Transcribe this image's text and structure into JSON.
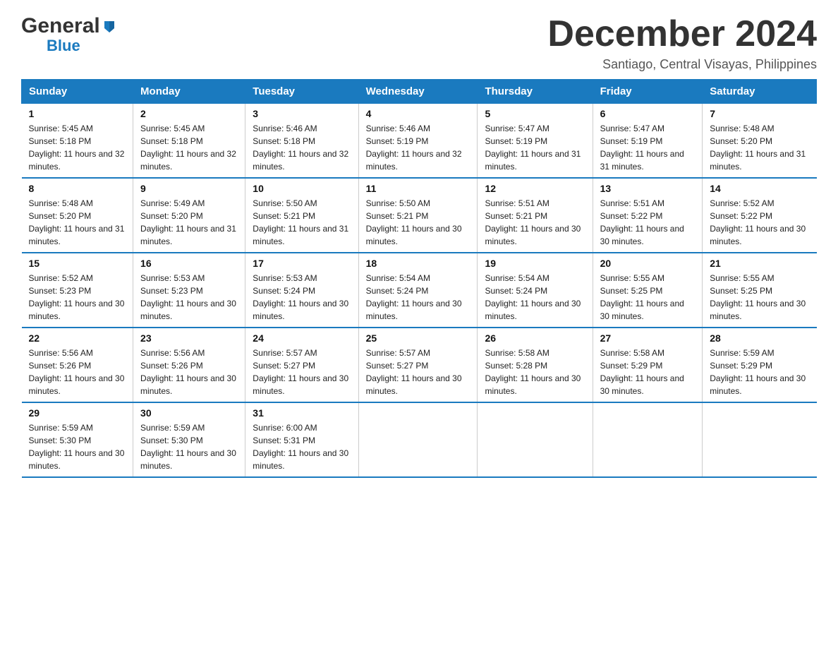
{
  "logo": {
    "general": "General",
    "blue": "Blue"
  },
  "title": {
    "month": "December 2024",
    "location": "Santiago, Central Visayas, Philippines"
  },
  "days_header": [
    "Sunday",
    "Monday",
    "Tuesday",
    "Wednesday",
    "Thursday",
    "Friday",
    "Saturday"
  ],
  "weeks": [
    [
      {
        "day": "1",
        "sunrise": "5:45 AM",
        "sunset": "5:18 PM",
        "daylight": "11 hours and 32 minutes."
      },
      {
        "day": "2",
        "sunrise": "5:45 AM",
        "sunset": "5:18 PM",
        "daylight": "11 hours and 32 minutes."
      },
      {
        "day": "3",
        "sunrise": "5:46 AM",
        "sunset": "5:18 PM",
        "daylight": "11 hours and 32 minutes."
      },
      {
        "day": "4",
        "sunrise": "5:46 AM",
        "sunset": "5:19 PM",
        "daylight": "11 hours and 32 minutes."
      },
      {
        "day": "5",
        "sunrise": "5:47 AM",
        "sunset": "5:19 PM",
        "daylight": "11 hours and 31 minutes."
      },
      {
        "day": "6",
        "sunrise": "5:47 AM",
        "sunset": "5:19 PM",
        "daylight": "11 hours and 31 minutes."
      },
      {
        "day": "7",
        "sunrise": "5:48 AM",
        "sunset": "5:20 PM",
        "daylight": "11 hours and 31 minutes."
      }
    ],
    [
      {
        "day": "8",
        "sunrise": "5:48 AM",
        "sunset": "5:20 PM",
        "daylight": "11 hours and 31 minutes."
      },
      {
        "day": "9",
        "sunrise": "5:49 AM",
        "sunset": "5:20 PM",
        "daylight": "11 hours and 31 minutes."
      },
      {
        "day": "10",
        "sunrise": "5:50 AM",
        "sunset": "5:21 PM",
        "daylight": "11 hours and 31 minutes."
      },
      {
        "day": "11",
        "sunrise": "5:50 AM",
        "sunset": "5:21 PM",
        "daylight": "11 hours and 30 minutes."
      },
      {
        "day": "12",
        "sunrise": "5:51 AM",
        "sunset": "5:21 PM",
        "daylight": "11 hours and 30 minutes."
      },
      {
        "day": "13",
        "sunrise": "5:51 AM",
        "sunset": "5:22 PM",
        "daylight": "11 hours and 30 minutes."
      },
      {
        "day": "14",
        "sunrise": "5:52 AM",
        "sunset": "5:22 PM",
        "daylight": "11 hours and 30 minutes."
      }
    ],
    [
      {
        "day": "15",
        "sunrise": "5:52 AM",
        "sunset": "5:23 PM",
        "daylight": "11 hours and 30 minutes."
      },
      {
        "day": "16",
        "sunrise": "5:53 AM",
        "sunset": "5:23 PM",
        "daylight": "11 hours and 30 minutes."
      },
      {
        "day": "17",
        "sunrise": "5:53 AM",
        "sunset": "5:24 PM",
        "daylight": "11 hours and 30 minutes."
      },
      {
        "day": "18",
        "sunrise": "5:54 AM",
        "sunset": "5:24 PM",
        "daylight": "11 hours and 30 minutes."
      },
      {
        "day": "19",
        "sunrise": "5:54 AM",
        "sunset": "5:24 PM",
        "daylight": "11 hours and 30 minutes."
      },
      {
        "day": "20",
        "sunrise": "5:55 AM",
        "sunset": "5:25 PM",
        "daylight": "11 hours and 30 minutes."
      },
      {
        "day": "21",
        "sunrise": "5:55 AM",
        "sunset": "5:25 PM",
        "daylight": "11 hours and 30 minutes."
      }
    ],
    [
      {
        "day": "22",
        "sunrise": "5:56 AM",
        "sunset": "5:26 PM",
        "daylight": "11 hours and 30 minutes."
      },
      {
        "day": "23",
        "sunrise": "5:56 AM",
        "sunset": "5:26 PM",
        "daylight": "11 hours and 30 minutes."
      },
      {
        "day": "24",
        "sunrise": "5:57 AM",
        "sunset": "5:27 PM",
        "daylight": "11 hours and 30 minutes."
      },
      {
        "day": "25",
        "sunrise": "5:57 AM",
        "sunset": "5:27 PM",
        "daylight": "11 hours and 30 minutes."
      },
      {
        "day": "26",
        "sunrise": "5:58 AM",
        "sunset": "5:28 PM",
        "daylight": "11 hours and 30 minutes."
      },
      {
        "day": "27",
        "sunrise": "5:58 AM",
        "sunset": "5:29 PM",
        "daylight": "11 hours and 30 minutes."
      },
      {
        "day": "28",
        "sunrise": "5:59 AM",
        "sunset": "5:29 PM",
        "daylight": "11 hours and 30 minutes."
      }
    ],
    [
      {
        "day": "29",
        "sunrise": "5:59 AM",
        "sunset": "5:30 PM",
        "daylight": "11 hours and 30 minutes."
      },
      {
        "day": "30",
        "sunrise": "5:59 AM",
        "sunset": "5:30 PM",
        "daylight": "11 hours and 30 minutes."
      },
      {
        "day": "31",
        "sunrise": "6:00 AM",
        "sunset": "5:31 PM",
        "daylight": "11 hours and 30 minutes."
      },
      null,
      null,
      null,
      null
    ]
  ]
}
